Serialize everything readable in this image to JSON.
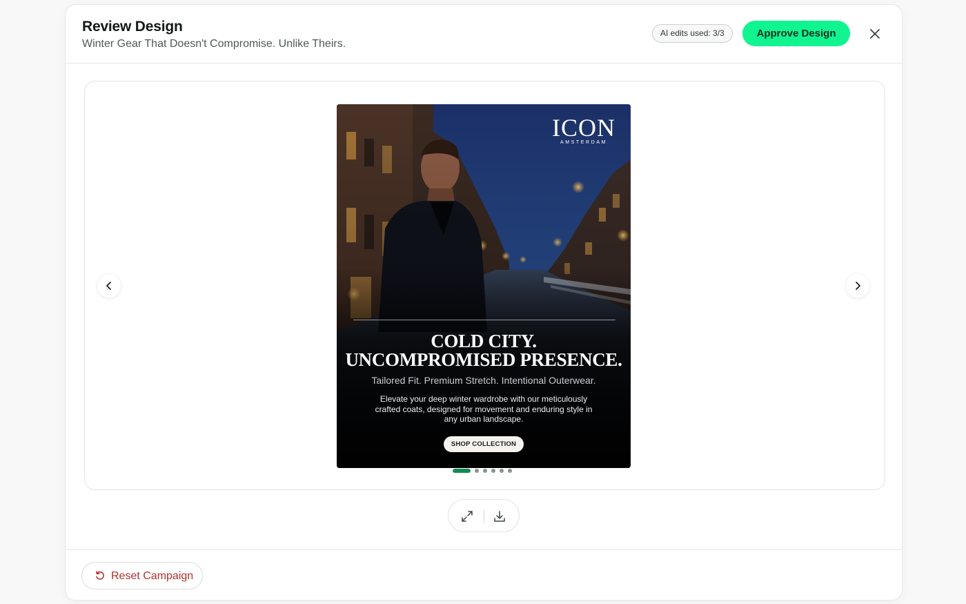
{
  "header": {
    "title": "Review Design",
    "subtitle": "Winter Gear That Doesn't Compromise. Unlike Theirs.",
    "ai_edits_label": "AI edits used: 3/3",
    "approve_label": "Approve Design",
    "close_icon": "close-icon"
  },
  "preview": {
    "prev_icon": "chevron-left-icon",
    "next_icon": "chevron-right-icon",
    "ad": {
      "brand_name": "ICON",
      "brand_sub": "AMSTERDAM",
      "headline_line1": "COLD CITY.",
      "headline_line2": "UNCOMPROMISED PRESENCE.",
      "tagline": "Tailored Fit. Premium Stretch. Intentional Outerwear.",
      "body": "Elevate your deep winter wardrobe with our meticulously crafted coats, designed for movement and enduring style in any urban landscape.",
      "cta": "SHOP COLLECTION"
    },
    "slides_total": 6,
    "active_slide": 1
  },
  "tools": {
    "expand_icon": "expand-icon",
    "download_icon": "download-icon"
  },
  "footer": {
    "reset_label": "Reset Campaign",
    "reset_icon": "reset-icon"
  },
  "colors": {
    "accent": "#10f58f",
    "active_dot": "#138a56",
    "danger_text": "#b0302c"
  }
}
